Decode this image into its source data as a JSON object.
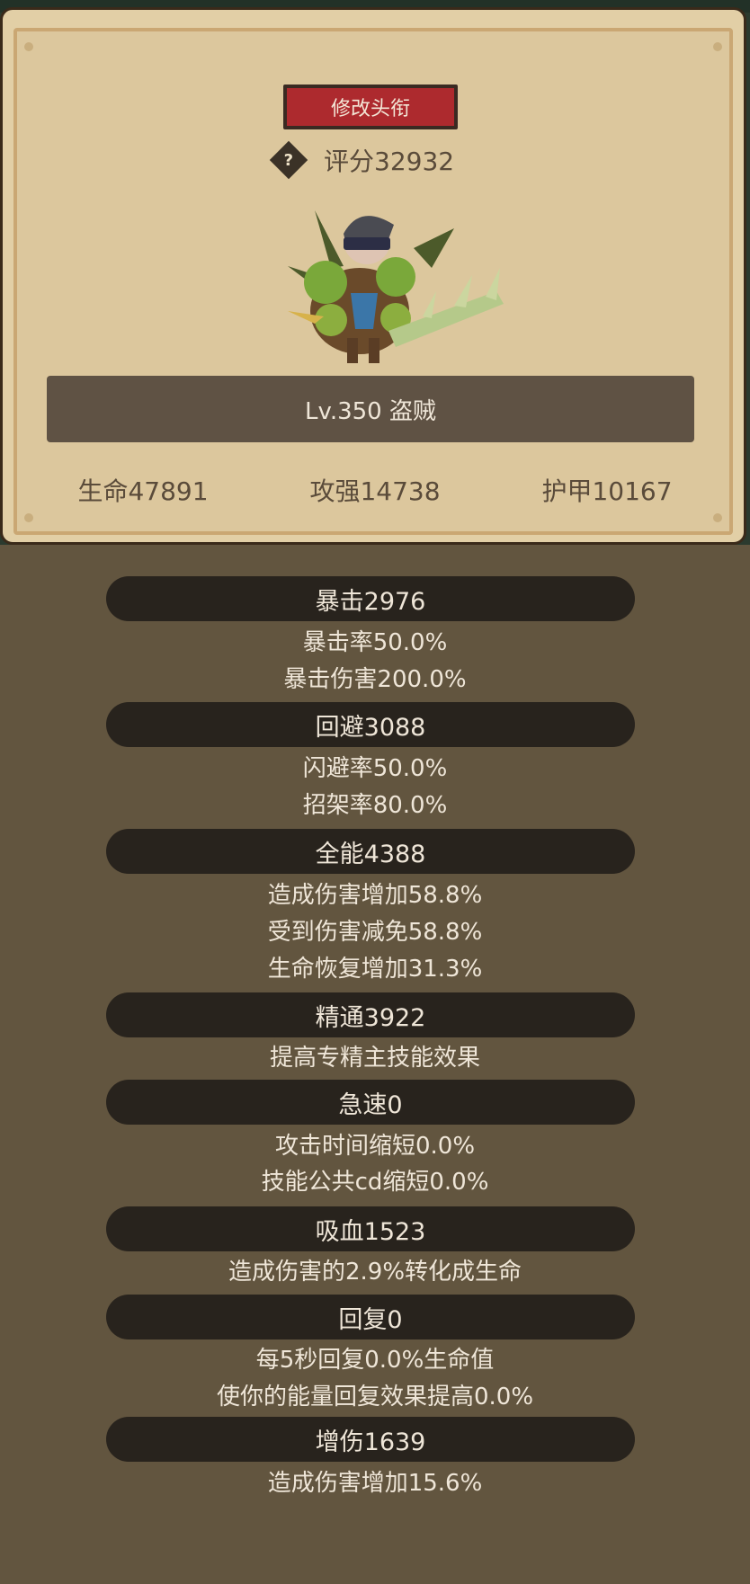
{
  "header": {
    "title_button": "修改头衔",
    "help_icon": "?",
    "score": "评分32932"
  },
  "hero": {
    "level_class": "Lv.350 盗贼"
  },
  "main_stats": [
    "生命47891",
    "攻强14738",
    "护甲10167"
  ],
  "sections": [
    {
      "title": "暴击2976",
      "lines": [
        "暴击率50.0%",
        "暴击伤害200.0%"
      ]
    },
    {
      "title": "回避3088",
      "lines": [
        "闪避率50.0%",
        "招架率80.0%"
      ]
    },
    {
      "title": "全能4388",
      "lines": [
        "造成伤害增加58.8%",
        "受到伤害减免58.8%",
        "生命恢复增加31.3%"
      ]
    },
    {
      "title": "精通3922",
      "lines": [
        "提高专精主技能效果"
      ]
    },
    {
      "title": "急速0",
      "lines": [
        "攻击时间缩短0.0%",
        "技能公共cd缩短0.0%"
      ]
    },
    {
      "title": "吸血1523",
      "lines": [
        "造成伤害的2.9%转化成生命"
      ]
    },
    {
      "title": "回复0",
      "lines": [
        "每5秒回复0.0%生命值",
        "使你的能量回复效果提高0.0%"
      ]
    },
    {
      "title": "增伤1639",
      "lines": [
        "造成伤害增加15.6%"
      ]
    }
  ]
}
